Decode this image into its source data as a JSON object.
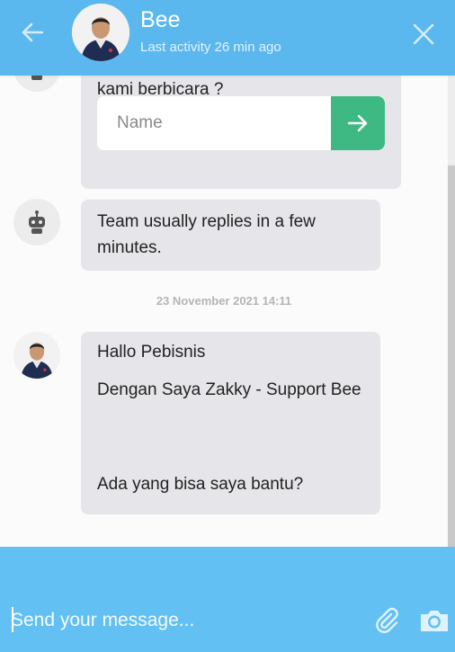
{
  "header": {
    "title": "Bee",
    "status": "Last activity 26 min ago"
  },
  "messages": {
    "bot_prompt_tail": "kami berbicara ?",
    "name_placeholder": "Name",
    "bot_reply_time": "Team usually replies in a few minutes.",
    "date_separator": "23 November 2021 14:11",
    "agent_line1": "Hallo Pebisnis",
    "agent_line2": "Dengan Saya Zakky - Support Bee",
    "agent_line3": "Ada yang bisa saya bantu?"
  },
  "composer": {
    "placeholder": "Send your message..."
  },
  "colors": {
    "header": "#5ab8ee",
    "composer": "#63c0f3",
    "submit": "#3fb984",
    "bubble": "#e6e6ea"
  },
  "icons": {
    "back": "back-arrow-icon",
    "close": "close-icon",
    "robot": "robot-icon",
    "submit": "arrow-right-icon",
    "attach": "paperclip-icon",
    "camera": "camera-icon"
  }
}
